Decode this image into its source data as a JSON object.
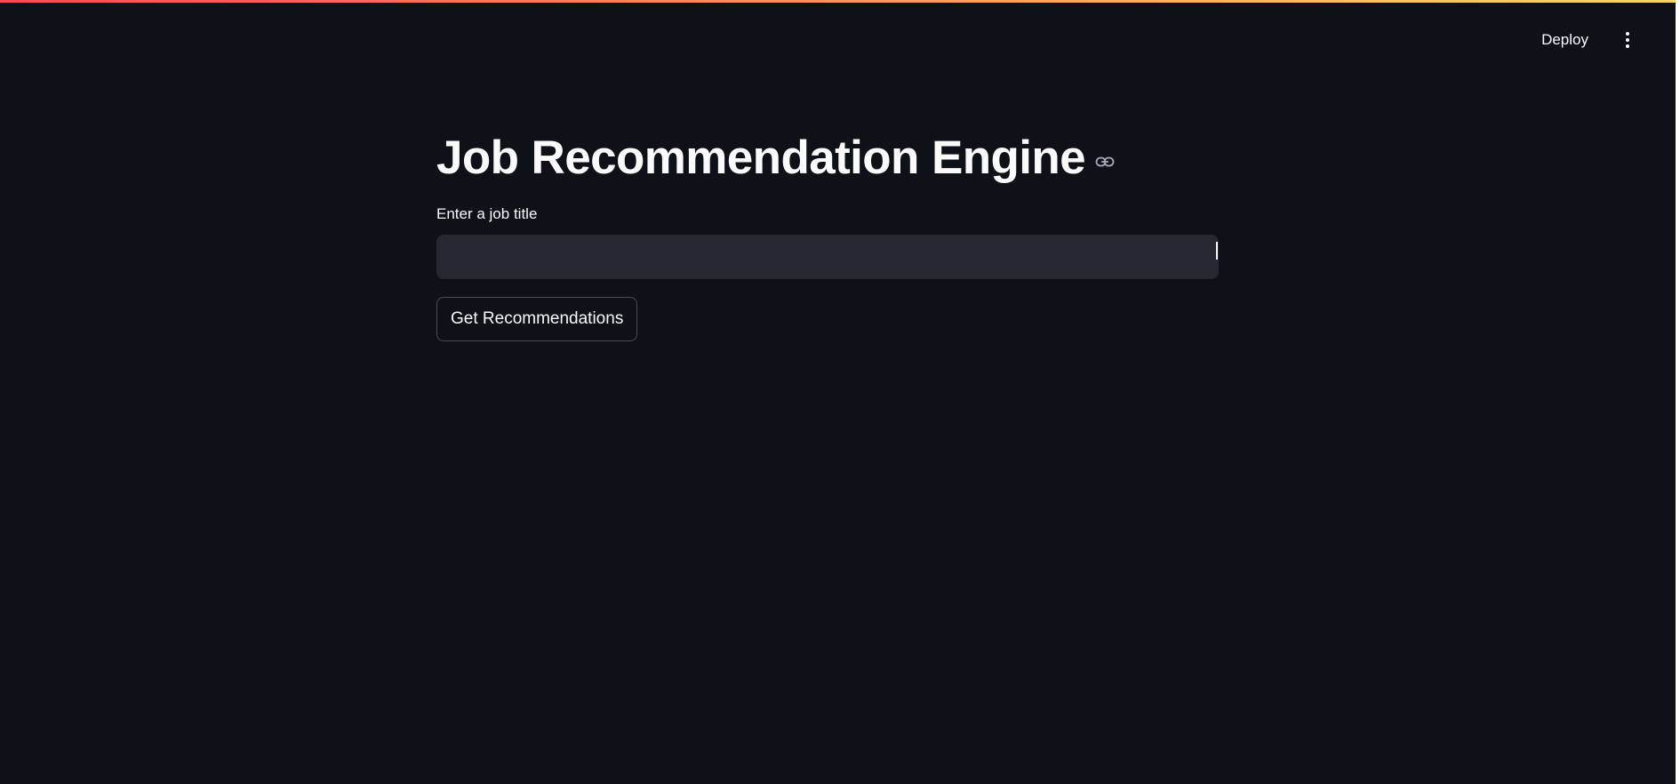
{
  "header": {
    "deploy_label": "Deploy",
    "menu_icon": "kebab-menu-icon"
  },
  "main": {
    "title": "Job Recommendation Engine",
    "title_link_icon": "link-icon",
    "input": {
      "label": "Enter a job title",
      "value": "",
      "placeholder": ""
    },
    "button_label": "Get Recommendations"
  },
  "colors": {
    "background": "#0e1117",
    "input_background": "#262730",
    "text": "#fafafa",
    "accent_start": "#ff4b4b",
    "accent_end": "#ffd36b"
  }
}
